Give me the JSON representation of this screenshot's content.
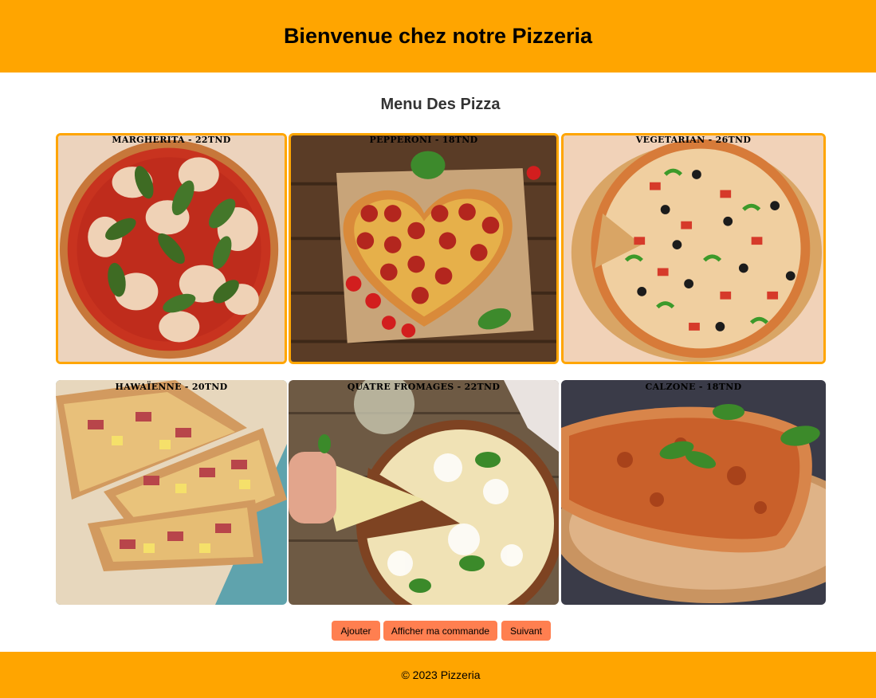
{
  "header": {
    "title": "Bienvenue chez notre Pizzeria"
  },
  "menu": {
    "title": "Menu Des Pizza",
    "items": [
      {
        "label": "Margherita - 22TND",
        "selected": true
      },
      {
        "label": "Pepperoni - 18TND",
        "selected": true
      },
      {
        "label": "Vegetarian - 26TND",
        "selected": true
      },
      {
        "label": "Hawaïenne - 20TND",
        "selected": false
      },
      {
        "label": "Quatre Fromages - 22TND",
        "selected": false
      },
      {
        "label": "Calzone - 18TND",
        "selected": false
      }
    ]
  },
  "actions": {
    "add_label": "Ajouter",
    "show_order_label": "Afficher ma commande",
    "next_label": "Suivant"
  },
  "footer": {
    "copyright": "© 2023 Pizzeria"
  },
  "colors": {
    "header_bg": "#ffa500",
    "footer_bg": "#ffa500",
    "selected_border": "#ffa500",
    "button_bg": "#ff7f50"
  }
}
